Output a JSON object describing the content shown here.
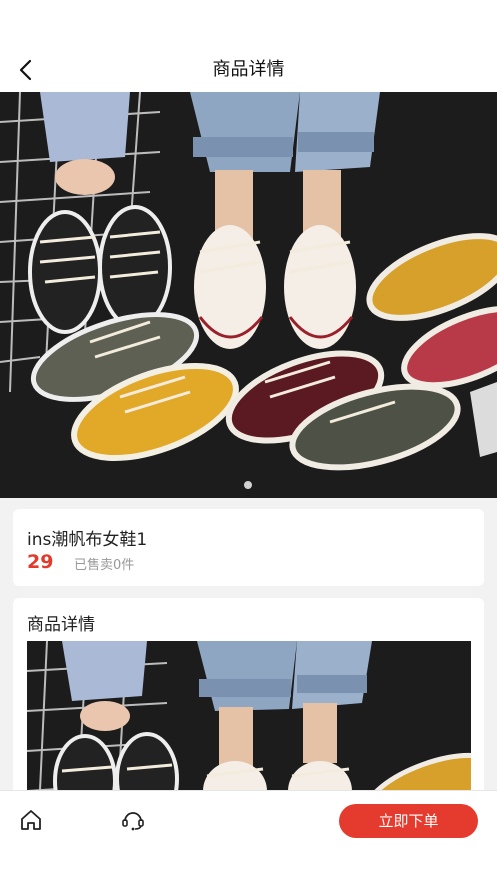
{
  "header": {
    "title": "商品详情"
  },
  "product": {
    "name": "ins潮帆布女鞋1",
    "price": "29",
    "sold": "已售卖0件"
  },
  "detail": {
    "title": "商品详情"
  },
  "bottom": {
    "buy_label": "立即下单"
  },
  "colors": {
    "accent": "#e53a2e",
    "price": "#e23b2c"
  },
  "icons": [
    "back-icon",
    "home-icon",
    "customer-service-icon"
  ],
  "banner": {
    "slide_count": 1,
    "active_slide": 1
  }
}
